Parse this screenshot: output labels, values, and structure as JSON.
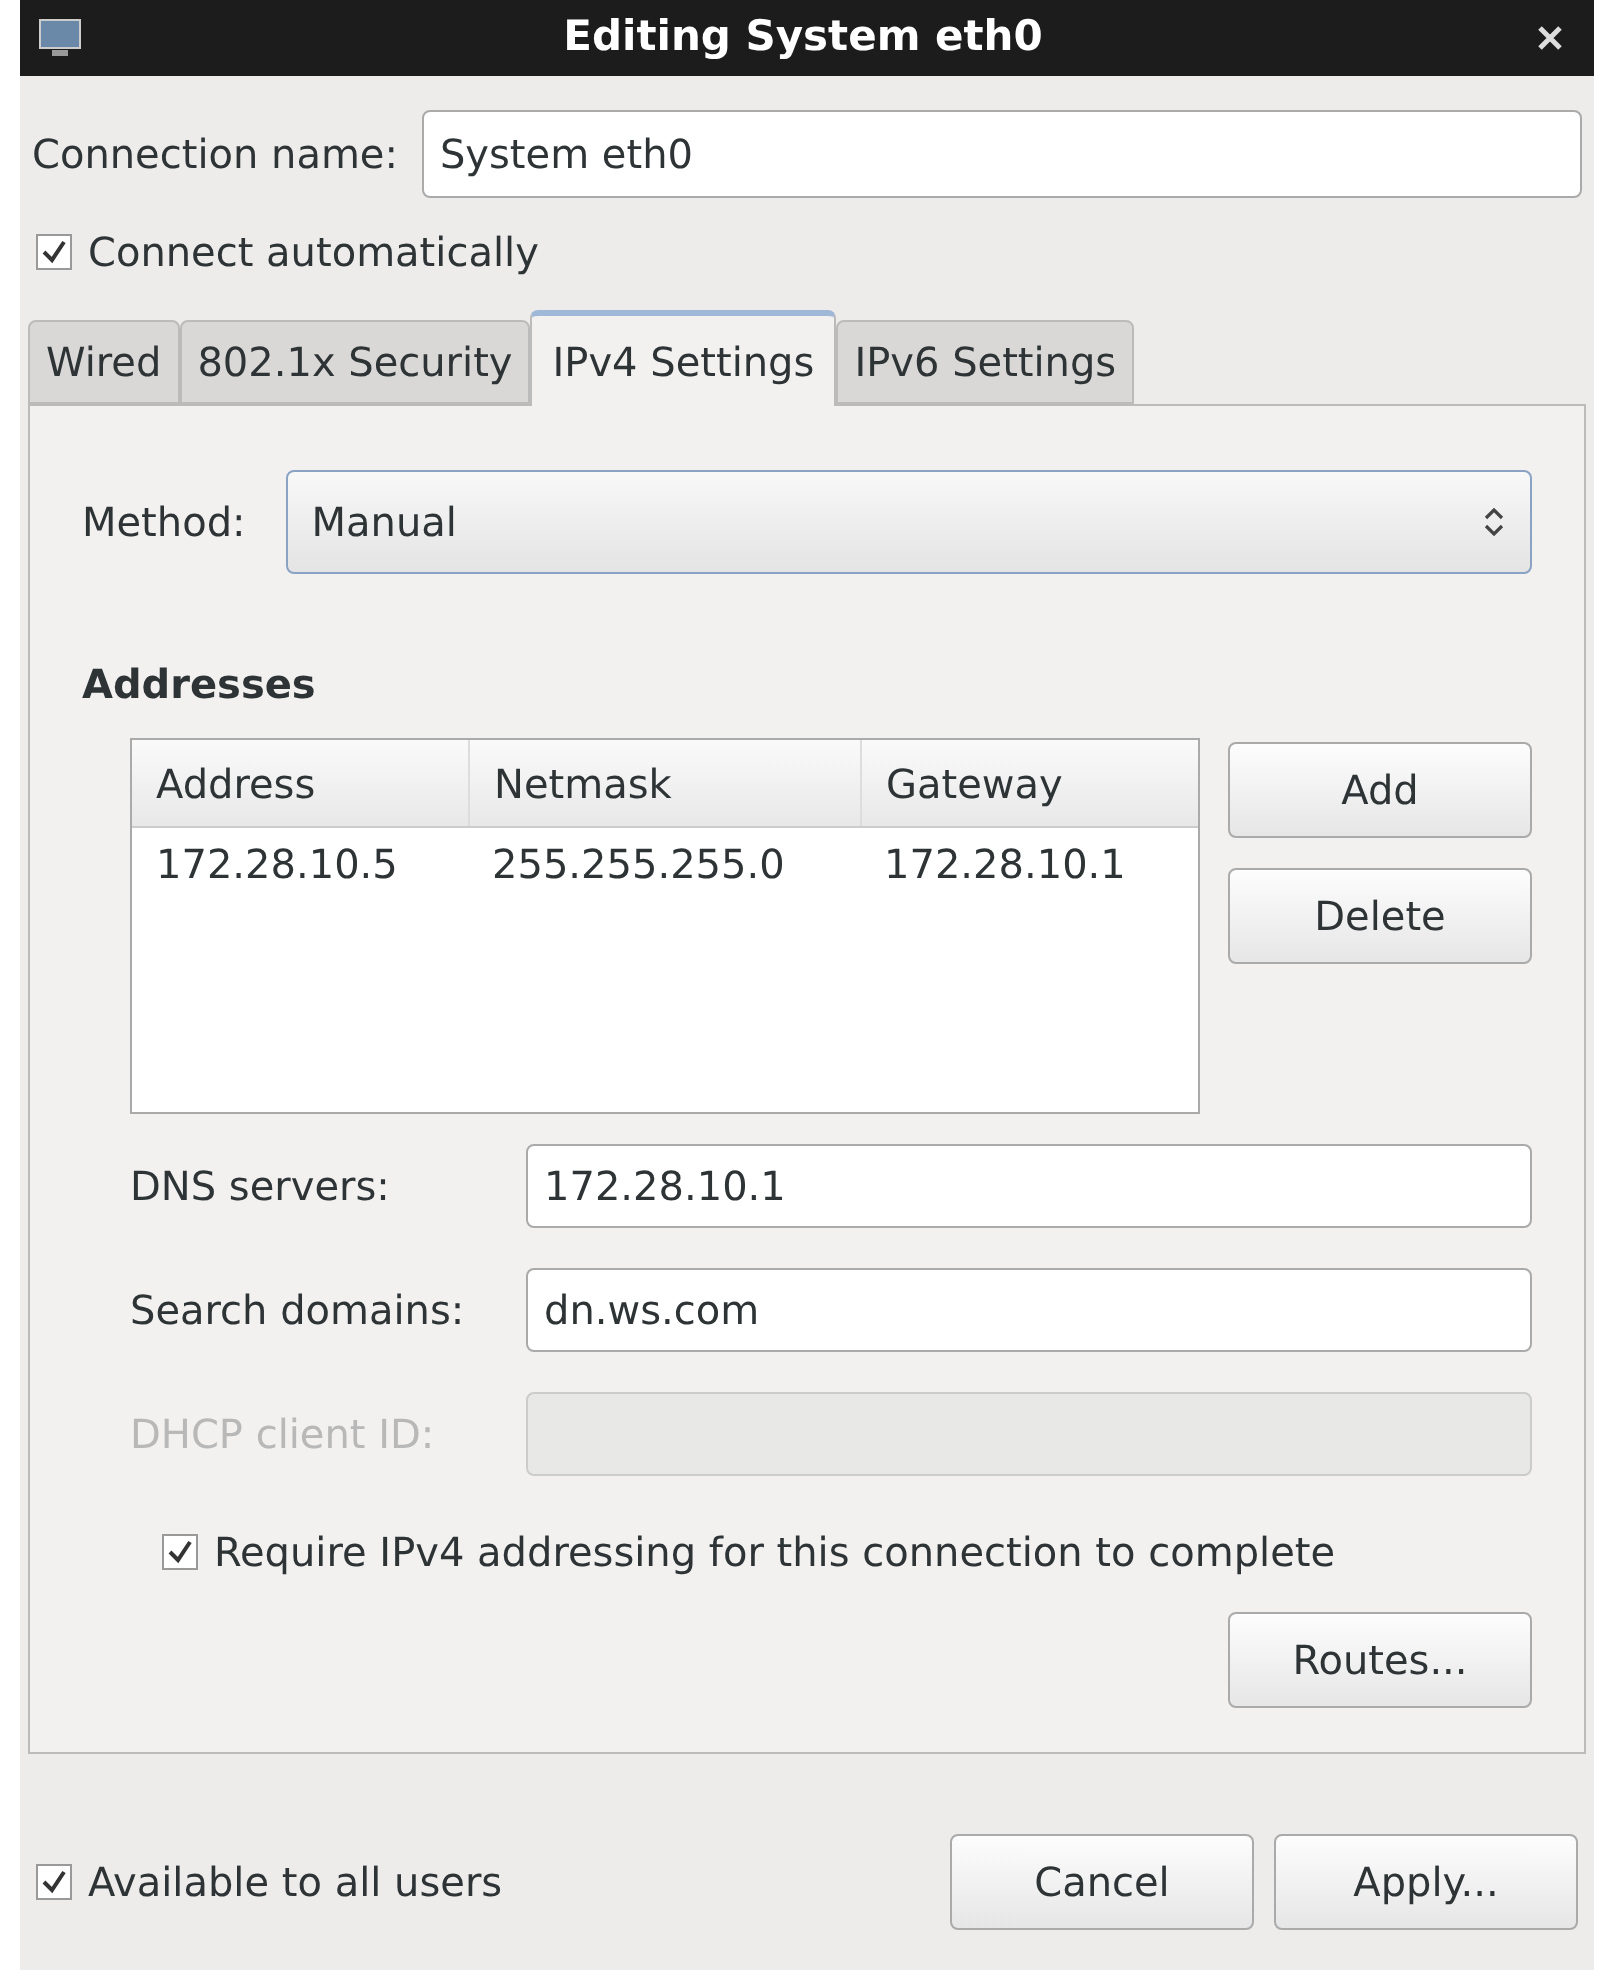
{
  "window": {
    "title": "Editing System eth0"
  },
  "connection_name": {
    "label": "Connection name:",
    "value": "System eth0"
  },
  "connect_automatically": {
    "label": "Connect automatically",
    "checked": true
  },
  "tabs": [
    {
      "label": "Wired",
      "selected": false
    },
    {
      "label": "802.1x Security",
      "selected": false
    },
    {
      "label": "IPv4 Settings",
      "selected": true
    },
    {
      "label": "IPv6 Settings",
      "selected": false
    }
  ],
  "method": {
    "label": "Method:",
    "value": "Manual"
  },
  "addresses": {
    "heading": "Addresses",
    "columns": [
      "Address",
      "Netmask",
      "Gateway"
    ],
    "rows": [
      [
        "172.28.10.5",
        "255.255.255.0",
        "172.28.10.1"
      ]
    ],
    "buttons": [
      "Add",
      "Delete"
    ]
  },
  "fields": [
    {
      "label": "DNS servers:",
      "value": "172.28.10.1",
      "disabled": false
    },
    {
      "label": "Search domains:",
      "value": "dn.ws.com",
      "disabled": false
    },
    {
      "label": "DHCP client ID:",
      "disabled": true
    }
  ],
  "require_ipv4": {
    "label": "Require IPv4 addressing for this connection to complete",
    "checked": true
  },
  "routes_button": "Routes...",
  "available_to_all_users": {
    "label": "Available to all users",
    "checked": true
  },
  "buttons": [
    "Cancel",
    "Apply..."
  ]
}
